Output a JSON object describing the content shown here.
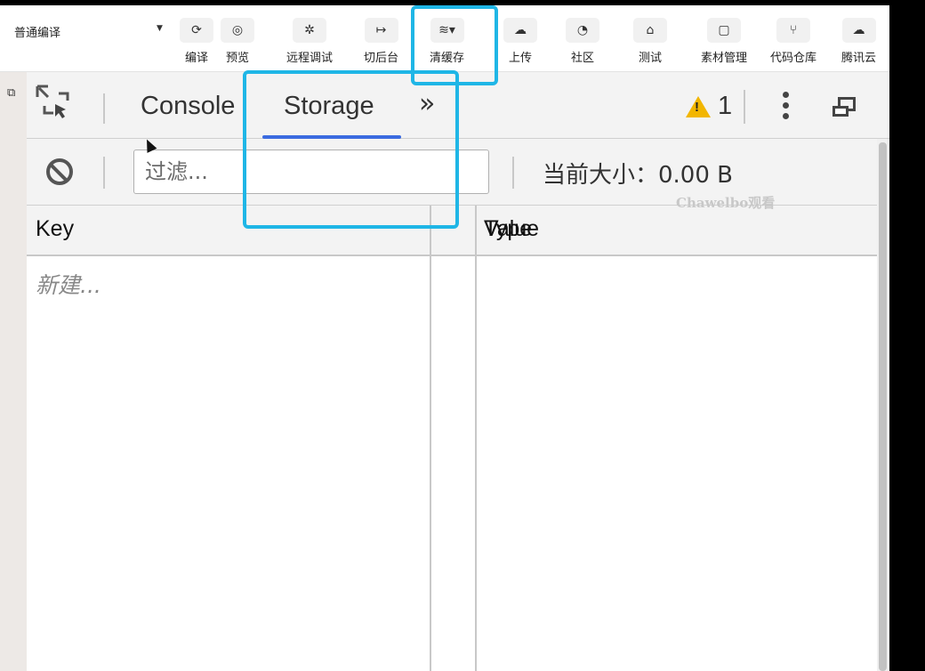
{
  "toolbar": {
    "compile_mode": "普通编译",
    "buttons": [
      {
        "icon": "refresh-icon",
        "glyph": "⟳",
        "label": "编译"
      },
      {
        "icon": "eye-icon",
        "glyph": "◎",
        "label": "预览"
      },
      {
        "icon": "bug-icon",
        "glyph": "✲",
        "label": "远程调试"
      },
      {
        "icon": "switch-background-icon",
        "glyph": "↦",
        "label": "切后台"
      },
      {
        "icon": "layers-icon",
        "glyph": "≋▾",
        "label": "清缓存"
      },
      {
        "icon": "cloud-upload-icon",
        "glyph": "☁",
        "label": "上传"
      },
      {
        "icon": "community-icon",
        "glyph": "◔",
        "label": "社区"
      },
      {
        "icon": "flask-icon",
        "glyph": "⌂",
        "label": "测试"
      },
      {
        "icon": "materials-icon",
        "glyph": "▢",
        "label": "素材管理"
      },
      {
        "icon": "git-icon",
        "glyph": "⑂",
        "label": "代码仓库"
      },
      {
        "icon": "tencent-cloud-icon",
        "glyph": "☁",
        "label": "腾讯云"
      }
    ]
  },
  "devtools": {
    "tabs": [
      "Console",
      "Storage"
    ],
    "active_tab": "Storage",
    "more_tabs": "»",
    "warning_count": "1",
    "filter": {
      "placeholder": "过滤..."
    },
    "size_label": "当前大小：0.00 B",
    "watermark": "Chawelbo观看",
    "columns": {
      "key": "Key",
      "type": "Type",
      "value": "Value"
    },
    "new_row": "新建..."
  },
  "colors": {
    "highlight": "#1fb6e6",
    "active_tab_underline": "#3b6be0",
    "warning": "#f2b600"
  }
}
